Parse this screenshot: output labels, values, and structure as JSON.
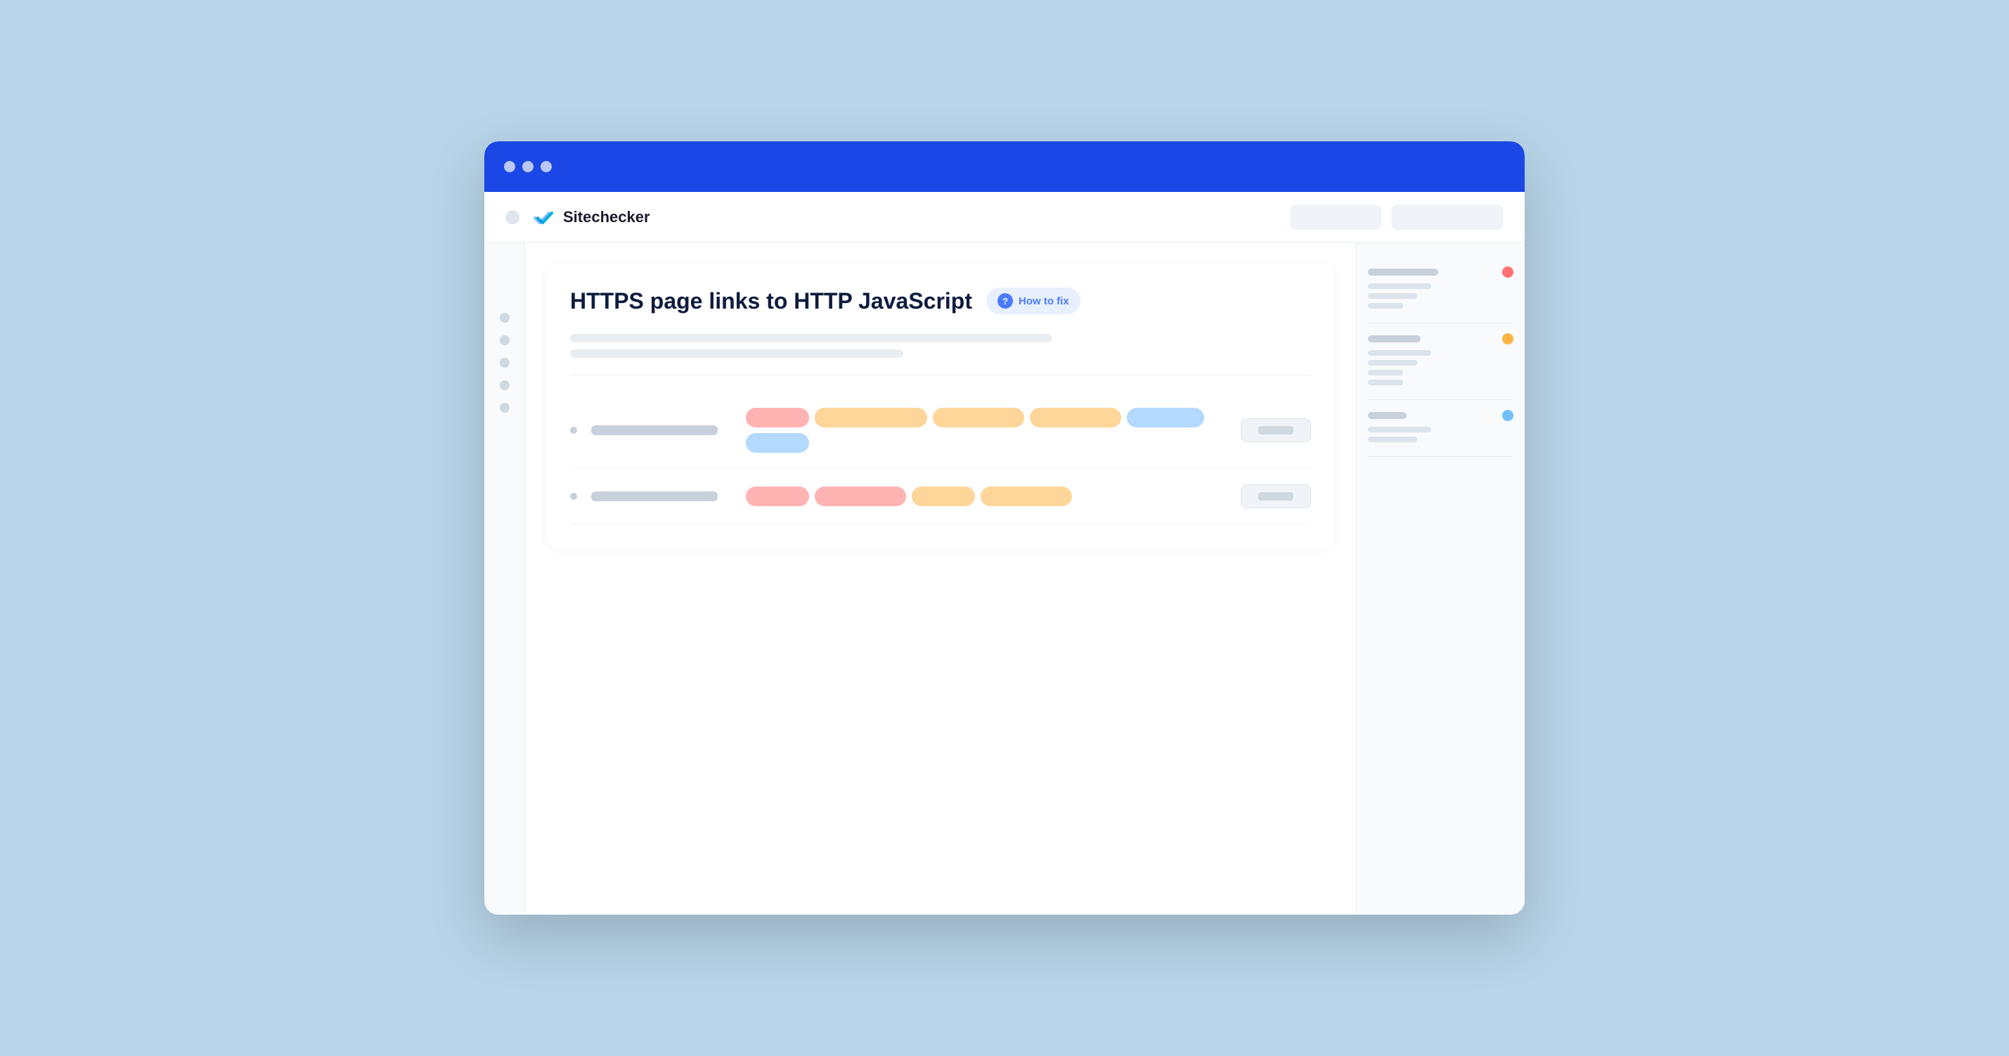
{
  "browser": {
    "titlebar_color": "#1a47e5",
    "dots": [
      "dot1",
      "dot2",
      "dot3"
    ]
  },
  "logo": {
    "text": "Sitechecker",
    "icon_alt": "sitechecker-logo"
  },
  "nav": {
    "button1_label": "",
    "button2_label": ""
  },
  "page": {
    "title": "HTTPS page links to HTTP JavaScript",
    "how_to_fix_label": "How to fix",
    "description_lines": [
      "line1",
      "line2"
    ]
  },
  "rows": [
    {
      "id": "row1",
      "tags": [
        {
          "color": "pink",
          "size": "sm"
        },
        {
          "color": "orange",
          "size": "lg"
        },
        {
          "color": "orange",
          "size": "md"
        },
        {
          "color": "orange",
          "size": "md"
        },
        {
          "color": "blue",
          "size": "xl"
        },
        {
          "color": "blue",
          "size": "sm"
        }
      ]
    },
    {
      "id": "row2",
      "tags": [
        {
          "color": "pink",
          "size": "sm"
        },
        {
          "color": "pink",
          "size": "md"
        },
        {
          "color": "orange",
          "size": "sm"
        },
        {
          "color": "orange",
          "size": "md"
        }
      ]
    }
  ],
  "right_sidebar": {
    "sections": [
      {
        "main_line": "long",
        "dot_color": "red",
        "sub_lines": [
          "long",
          "med",
          "short"
        ]
      },
      {
        "main_line": "med",
        "dot_color": "orange",
        "sub_lines": [
          "long",
          "med",
          "short",
          "xs"
        ]
      },
      {
        "main_line": "short",
        "dot_color": "blue",
        "sub_lines": [
          "long",
          "med"
        ]
      }
    ]
  }
}
